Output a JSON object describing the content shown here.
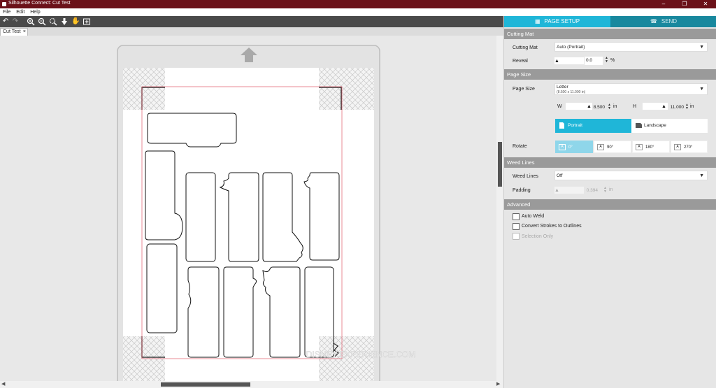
{
  "window": {
    "title": "Silhouette Connect: Cut Test",
    "app_icon": "silhouette-icon"
  },
  "menu": [
    "File",
    "Edit",
    "Help"
  ],
  "toolbar": {
    "icons": [
      "undo-icon",
      "redo-icon",
      "zoom-in-icon",
      "zoom-out-icon",
      "zoom-selection-icon",
      "move-down-icon",
      "pan-hand-icon",
      "fit-to-page-icon"
    ]
  },
  "document_tab": {
    "label": "Cut Test",
    "close": "×"
  },
  "panel": {
    "tabs": [
      {
        "label": "PAGE SETUP",
        "icon": "grid-icon",
        "active": true
      },
      {
        "label": "SEND",
        "icon": "send-machine-icon",
        "active": false
      }
    ],
    "sections": {
      "cutting_mat": "Cutting Mat",
      "page_size": "Page Size",
      "weed_lines": "Weed Lines",
      "advanced": "Advanced"
    },
    "cutting_mat_label": "Cutting Mat",
    "cutting_mat_value": "Auto (Portrait)",
    "reveal_label": "Reveal",
    "reveal_value": "0.0",
    "reveal_unit": "%",
    "page_size_label": "Page Size",
    "page_size_value": "Letter",
    "page_size_sub": "(8.500 x 11.000 in)",
    "w_label": "W",
    "w_value": "8.500",
    "w_unit": "in",
    "h_label": "H",
    "h_value": "11.000",
    "h_unit": "in",
    "orientation": {
      "portrait": "Portrait",
      "landscape": "Landscape",
      "selected": "Portrait"
    },
    "rotate_label": "Rotate",
    "rotate_options": [
      "0°",
      "90°",
      "180°",
      "270°"
    ],
    "rotate_selected": "0°",
    "weed_lines_label": "Weed Lines",
    "weed_lines_value": "Off",
    "padding_label": "Padding",
    "padding_value": "0.394",
    "padding_unit": "in",
    "advanced_options": [
      {
        "label": "Auto Weld",
        "checked": false,
        "disabled": false
      },
      {
        "label": "Convert Strokes to Outlines",
        "checked": false,
        "disabled": false
      },
      {
        "label": "Selection Only",
        "checked": false,
        "disabled": true
      }
    ]
  },
  "colors": {
    "titlebar": "#6b1119",
    "accent": "#1fb6d8",
    "accent_dark": "#18889e",
    "section_header": "#9a9a9a",
    "cut_margin": "#e05a6a"
  },
  "watermark": "DISNEY EXPERIENCE.COM"
}
